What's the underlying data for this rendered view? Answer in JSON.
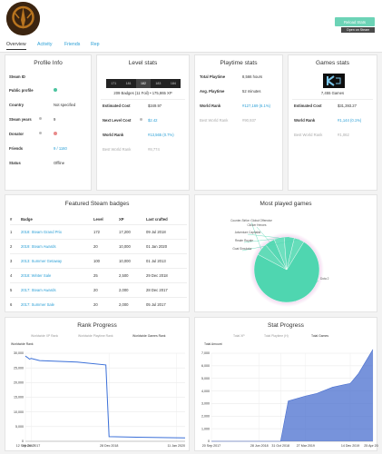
{
  "header": {
    "reload_label": "Reload Stats",
    "open_steam_label": "Open on Steam"
  },
  "tabs": [
    {
      "label": "Overview",
      "active": true
    },
    {
      "label": "Activity",
      "active": false
    },
    {
      "label": "Friends",
      "active": false
    },
    {
      "label": "Rep",
      "active": false
    }
  ],
  "profile_info": {
    "title": "Profile Info",
    "rows": [
      {
        "label": "Steam ID",
        "value": ""
      },
      {
        "label": "Public profile",
        "value": "",
        "status": "ok"
      },
      {
        "label": "Country",
        "value": "Not specified"
      },
      {
        "label": "Steam years",
        "value": "9"
      },
      {
        "label": "Donator",
        "value": "",
        "status": "no"
      },
      {
        "label": "Friends",
        "value": "9 / 1160"
      },
      {
        "label": "Status",
        "value": "Offline"
      }
    ],
    "colors": {
      "ok": "#4cc4a0",
      "no": "#e88a8a"
    }
  },
  "level_stats": {
    "title": "Level stats",
    "levels": [
      "171",
      "181",
      "182",
      "183",
      "184"
    ],
    "current_level": "182",
    "badges_line": "209 Badges (11 Foil) • 175,865 XP",
    "rows": [
      {
        "label": "Estimated Cost",
        "value": "$349.97",
        "muted": false,
        "link": false
      },
      {
        "label": "Next Level Cost",
        "value": "$2.42",
        "muted": false,
        "link": true
      },
      {
        "label": "World Rank",
        "value": "#13,565 (0.7%)",
        "muted": false,
        "link": true
      },
      {
        "label": "Best World Rank",
        "value": "#8,774",
        "muted": true,
        "link": false
      }
    ]
  },
  "playtime_stats": {
    "title": "Playtime stats",
    "rows": [
      {
        "label": "Total Playtime",
        "value": "8,566 hours",
        "muted": false,
        "link": false
      },
      {
        "label": "Avg. Playtime",
        "value": "52 minutes",
        "muted": false,
        "link": false
      },
      {
        "label": "World Rank",
        "value": "#127,169 (6.1%)",
        "muted": false,
        "link": true
      },
      {
        "label": "Best World Rank",
        "value": "#90,937",
        "muted": true,
        "link": false
      }
    ]
  },
  "games_stats": {
    "title": "Games stats",
    "logo_text": "K",
    "games_count": "7,455 Games",
    "rows": [
      {
        "label": "Estimated Cost",
        "value": "$31,393.27",
        "muted": false,
        "link": false
      },
      {
        "label": "World Rank",
        "value": "#1,144 (0.1%)",
        "muted": false,
        "link": true
      },
      {
        "label": "Best World Rank",
        "value": "#1,062",
        "muted": true,
        "link": false
      }
    ]
  },
  "featured_badges": {
    "title": "Featured Steam badges",
    "columns": [
      "#",
      "Badge",
      "Level",
      "XP",
      "Last crafted"
    ],
    "rows": [
      [
        "1",
        "2018: Steam Grand Prix",
        "172",
        "17,200",
        "09 Jul 2018"
      ],
      [
        "2",
        "2019: Steam Awards",
        "20",
        "10,000",
        "01 Jan 2020"
      ],
      [
        "3",
        "2013: Summer Getaway",
        "100",
        "10,000",
        "01 Jul 2013"
      ],
      [
        "4",
        "2018: Winter Sale",
        "25",
        "2,500",
        "29 Dec 2018"
      ],
      [
        "5",
        "2017: Steam Awards",
        "20",
        "2,000",
        "28 Dec 2017"
      ],
      [
        "6",
        "2017: Summer Sale",
        "20",
        "2,000",
        "05 Jul 2017"
      ]
    ]
  },
  "most_played": {
    "title": "Most played games",
    "chart_data": {
      "type": "pie",
      "labels": [
        "Dota 2",
        "Counter-Strike: Global Offensive",
        "Clicker Heroes",
        "Adventure Capitalist",
        "Realm Royale",
        "Goat Simulator"
      ],
      "values": [
        74,
        6,
        5,
        5,
        5,
        5
      ],
      "colors": [
        "#4fd6b0",
        "#63dbb8",
        "#58d8b4",
        "#6ee0bf",
        "#5ad9b6",
        "#66ddba"
      ]
    }
  },
  "rank_progress": {
    "title": "Rank Progress",
    "chart_data": {
      "type": "line",
      "legend": [
        "Worldwide XP Rank",
        "Worldwide Playtime Rank",
        "Worldwide Games Rank"
      ],
      "ylabel": "Worldwide Rank",
      "x_ticks": [
        "12 Sep 2017",
        "15 Oct 2017",
        "28 Dec 2018",
        "11 Jan 2020"
      ],
      "y_ticks": [
        "0",
        "5,000",
        "10,000",
        "15,000",
        "20,000",
        "25,000",
        "30,000"
      ],
      "ylim": [
        0,
        30000
      ],
      "series": [
        {
          "name": "Worldwide Games Rank",
          "x": [
            "12 Sep 2017",
            "25 Sep 2017",
            "5 Oct 2017",
            "15 Oct 2017",
            "1 Dec 2017",
            "1 Jul 2018",
            "10 Dec 2018",
            "28 Dec 2018",
            "1 Jun 2019",
            "11 Jan 2020",
            "1 Mar 2020"
          ],
          "values": [
            29000,
            28500,
            28000,
            28200,
            27500,
            27000,
            26000,
            1600,
            1400,
            1200,
            1150
          ]
        }
      ],
      "color": "#3a6fd8"
    }
  },
  "stat_progress": {
    "title": "Stat Progress",
    "chart_data": {
      "type": "area",
      "legend": [
        "Total XP",
        "Total Playtime (H)",
        "Total Games"
      ],
      "ylabel": "Total Amount",
      "x_ticks": [
        "20 Sep 2017",
        "28 Jun 2018",
        "31 Oct 2018",
        "27 Mar 2019",
        "14 Dec 2019",
        "25 Apr 2020"
      ],
      "y_ticks": [
        "0",
        "1,000",
        "2,000",
        "3,000",
        "4,000",
        "5,000",
        "6,000",
        "7,000"
      ],
      "ylim": [
        0,
        7000
      ],
      "series": [
        {
          "name": "Total Games",
          "x": [
            "20 Sep 2017",
            "28 Jun 2018",
            "31 Oct 2018",
            "15 Dec 2018",
            "27 Mar 2019",
            "1 Jun 2019",
            "1 Sep 2019",
            "14 Dec 2019",
            "1 Feb 2020",
            "25 Apr 2020"
          ],
          "values": [
            0,
            0,
            0,
            3200,
            3600,
            3800,
            4300,
            4600,
            5400,
            7300
          ]
        }
      ],
      "color": "#4a6fcf"
    }
  }
}
